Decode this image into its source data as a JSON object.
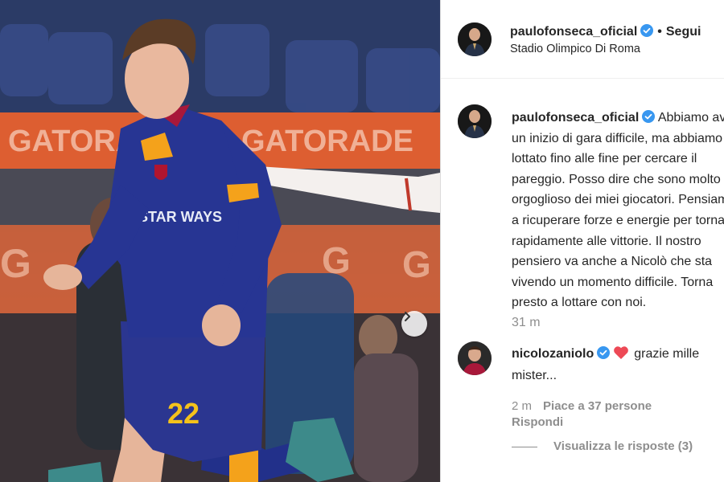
{
  "post": {
    "author": "paulofonseca_oficial",
    "follow_label": "Segui",
    "location": "Stadio Olimpico Di Roma",
    "player_number": "22",
    "sponsor_text": "STAR WAYS",
    "banner_text": "GATORADE"
  },
  "caption": {
    "username": "paulofonseca_oficial",
    "lines": [
      "Abbiamo avuto",
      "un inizio di gara difficile, ma abbiamo",
      "lottato fino alle fine per cercare il",
      "pareggio. Posso dire che sono molto",
      "orgoglioso dei miei giocatori. Pensiamo",
      "a ricuperare forze e energie per tornare",
      "rapidamente alle vittorie. Il nostro",
      "pensiero va anche a Nicolò che sta",
      "vivendo un momento difficile. Torna",
      "presto a lottare con noi."
    ],
    "time": "31 m"
  },
  "comment": {
    "username": "nicolozaniolo",
    "text_line1": "grazie mille",
    "text_line2": "mister...",
    "time": "2 m",
    "likes": "Piace a 37 persone",
    "reply_label": "Rispondi",
    "view_replies": "Visualizza le risposte (3)"
  },
  "colors": {
    "verified": "#3897f0",
    "heart": "#ed4956",
    "muted_text": "#8e8e8e",
    "jersey": "#22308a",
    "jersey_trim": "#f4a21b"
  },
  "icons": [
    "verified-badge-icon",
    "heart-icon",
    "chevron-right-icon"
  ]
}
